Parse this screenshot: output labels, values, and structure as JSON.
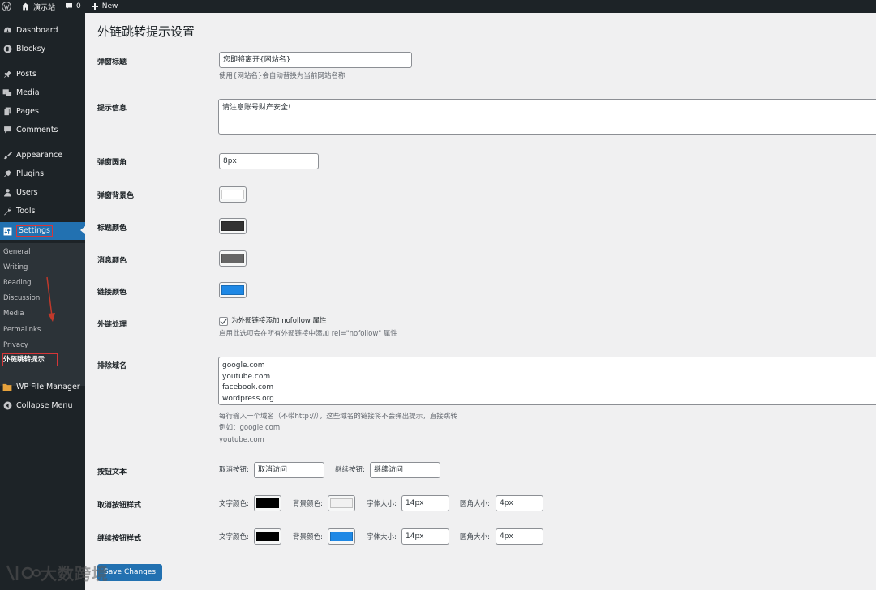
{
  "adminbar": {
    "site_name": "演示站",
    "comments_count": "0",
    "new_label": "New"
  },
  "sidebar": {
    "items": [
      {
        "label": "Dashboard",
        "icon": "dashboard-icon"
      },
      {
        "label": "Blocksy",
        "icon": "blocksy-icon"
      },
      {
        "label": "Posts",
        "icon": "pin-icon"
      },
      {
        "label": "Media",
        "icon": "media-icon"
      },
      {
        "label": "Pages",
        "icon": "pages-icon"
      },
      {
        "label": "Comments",
        "icon": "comments-icon"
      },
      {
        "label": "Appearance",
        "icon": "brush-icon"
      },
      {
        "label": "Plugins",
        "icon": "plugin-icon"
      },
      {
        "label": "Users",
        "icon": "users-icon"
      },
      {
        "label": "Tools",
        "icon": "wrench-icon"
      },
      {
        "label": "Settings",
        "icon": "settings-icon"
      },
      {
        "label": "WP File Manager",
        "icon": "folder-icon"
      },
      {
        "label": "Collapse Menu",
        "icon": "collapse-icon"
      }
    ],
    "submenu": [
      "General",
      "Writing",
      "Reading",
      "Discussion",
      "Media",
      "Permalinks",
      "Privacy",
      "外链跳转提示"
    ]
  },
  "page": {
    "title": "外链跳转提示设置",
    "popup_title_label": "弹窗标题",
    "popup_title_value": "您即将离开{网站名}",
    "popup_title_desc": "使用{网站名}会自动替换为当前网站名称",
    "message_label": "提示信息",
    "message_value": "请注意账号财产安全!",
    "radius_label": "弹窗圆角",
    "radius_value": "8px",
    "bg_color_label": "弹窗背景色",
    "title_color_label": "标题颜色",
    "msg_color_label": "消息颜色",
    "link_color_label": "链接颜色",
    "external_label": "外链处理",
    "nofollow_label": "为外部链接添加 nofollow 属性",
    "nofollow_desc": "启用此选项会在所有外部链接中添加 rel=\"nofollow\" 属性",
    "exclude_label": "排除域名",
    "exclude_value": "google.com\nyoutube.com\nfacebook.com\nwordpress.org",
    "exclude_desc_1": "每行输入一个域名（不带http://），这些域名的链接将不会弹出提示，直接跳转",
    "exclude_desc_2": "例如：google.com",
    "exclude_desc_3": "youtube.com",
    "button_text_label": "按钮文本",
    "cancel_btn_label": "取消按钮:",
    "cancel_btn_value": "取消访问",
    "continue_btn_label": "继续按钮:",
    "continue_btn_value": "继续访问",
    "cancel_style_label": "取消按钮样式",
    "continue_style_label": "继续按钮样式",
    "text_color_label": "文字颜色:",
    "bg_color_inline_label": "背景颜色:",
    "font_size_label": "字体大小:",
    "radius_inline_label": "圆角大小:",
    "cancel_font_size": "14px",
    "cancel_radius": "4px",
    "continue_font_size": "14px",
    "continue_radius": "4px",
    "save_label": "Save Changes"
  },
  "colors": {
    "popup_bg": "#ffffff",
    "title": "#333333",
    "message": "#666666",
    "link": "#1e88e5",
    "cancel_text": "#000000",
    "cancel_bg": "#f1f1f1",
    "continue_text": "#000000",
    "continue_bg": "#1e88e5",
    "admin_accent": "#2271b1"
  },
  "watermark": {
    "text": "大数跨境"
  }
}
